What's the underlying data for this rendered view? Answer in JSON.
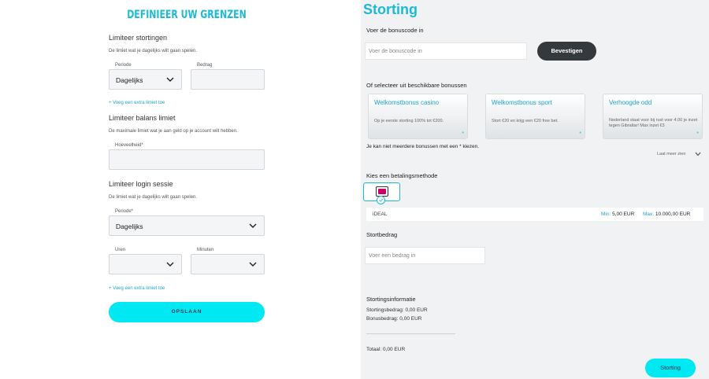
{
  "limits": {
    "title": "DEFINIEER UW GRENZEN",
    "deposit": {
      "title": "Limiteer stortingen",
      "desc": "De limiet wat je dagelijks wilt gaan spelen.",
      "period_label": "Periode",
      "period_value": "Dagelijks",
      "amount_label": "Bedrag",
      "add_link": "+ Voeg een extra limiet toe"
    },
    "balance": {
      "title": "Limiteer balans limiet",
      "desc": "De maximale limiet wat je aan geld op je account wilt hebben.",
      "amount_label": "Hoeveelheid*"
    },
    "session": {
      "title": "Limiteer login sessie",
      "desc": "De limiet wat je dagelijks wilt gaan spelen.",
      "period_label": "Periode*",
      "period_value": "Dagelijks",
      "hours_label": "Uren",
      "minutes_label": "Minuten",
      "add_link": "+ Voeg een extra limiet toe"
    },
    "save_label": "OPSLAAN"
  },
  "deposit": {
    "title": "Storting",
    "bonus_code_label": "Voer de bonuscode in",
    "bonus_code_placeholder": "Voer de bonuscode in",
    "confirm_label": "Bevestigen",
    "bonus_select_label": "Of selecteer uit beschikbare bonussen",
    "bonuses": [
      {
        "title": "Welkomstbonus casino",
        "desc": "Op je eerste storting 100% tot €200."
      },
      {
        "title": "Welkomstbonus sport",
        "desc": "Stort €20 en krijg een €20 free bet."
      },
      {
        "title": "Verhoogde odd",
        "desc": "Nederland staat voor bij rust voor 4.00 je inzet tegen Gibraltar! Max inzet €3"
      }
    ],
    "bonus_star": "*",
    "multi_note": "Je kan niet meerdere bonussen met een * kiezen.",
    "less_more": "Laat meer zien",
    "payment_label": "Kies een betalingsmethode",
    "method": {
      "name": "iDEAL",
      "min_key": "Min:",
      "min_val": "5,00 EUR",
      "max_key": "Max:",
      "max_val": "10.000,00 EUR"
    },
    "amount_label": "Stortbedrag",
    "amount_placeholder": "Voer een bedrag in",
    "info_title": "Stortingsinformatie",
    "info_deposit": "Stortingsbedrag: 0,00 EUR",
    "info_bonus": "Bonusbedrag: 0,00 EUR",
    "total": "Totaal: 0,00 EUR",
    "submit_label": "Storting"
  },
  "colors": {
    "accent": "#1bb9d6",
    "button": "#00e8f2",
    "dark": "#34393e"
  }
}
